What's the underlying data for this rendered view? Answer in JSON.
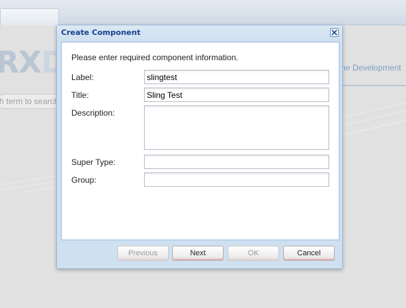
{
  "background": {
    "logo_text": "RX",
    "logo_text_faded": "D",
    "search_placeholder": "h term to search",
    "nav_link": "me Development"
  },
  "dialog": {
    "title": "Create Component",
    "intro": "Please enter required component information.",
    "fields": {
      "label": {
        "label": "Label:",
        "value": "slingtest"
      },
      "title": {
        "label": "Title:",
        "value": "Sling Test"
      },
      "description": {
        "label": "Description:",
        "value": ""
      },
      "super_type": {
        "label": "Super Type:",
        "value": ""
      },
      "group": {
        "label": "Group:",
        "value": ""
      }
    },
    "buttons": {
      "previous": "Previous",
      "next": "Next",
      "ok": "OK",
      "cancel": "Cancel"
    }
  },
  "colors": {
    "dialog_title": "#15428b",
    "dialog_frame": "#cfe0f0",
    "button_accent": "#e7b2b2"
  }
}
